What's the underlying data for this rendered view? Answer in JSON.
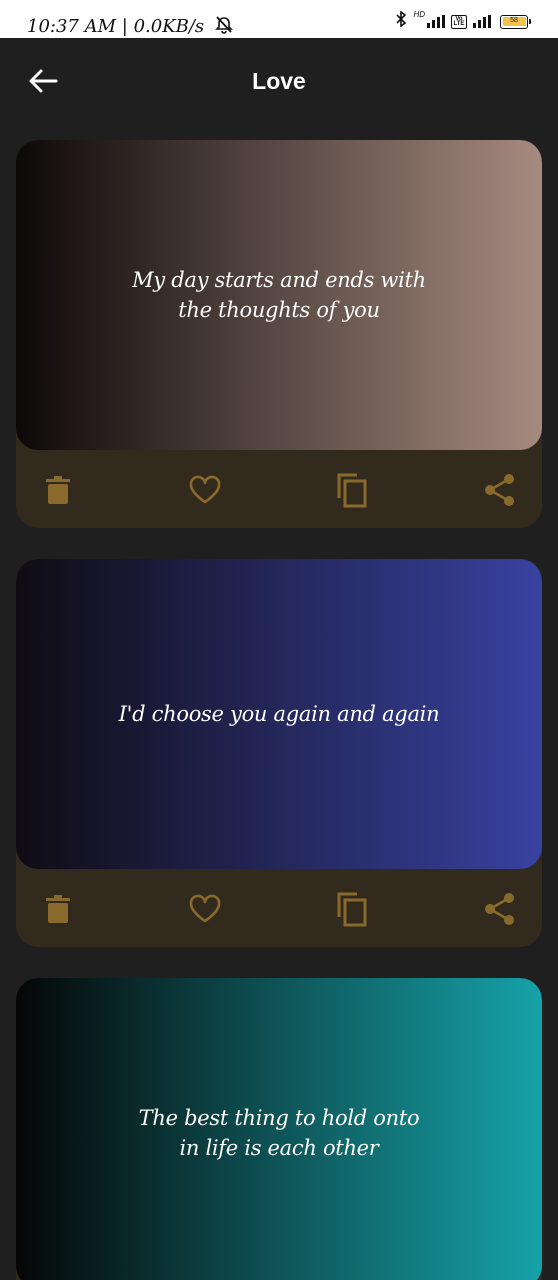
{
  "status_bar": {
    "time": "10:37 AM",
    "speed": "0.0KB/s",
    "network_hd_label": "HD",
    "volte_label": "Vo LTE",
    "battery_level": "58"
  },
  "app_bar": {
    "title": "Love"
  },
  "accent_color": "#7a5c26",
  "cards": [
    {
      "text": "My day starts and ends with\nthe thoughts of you",
      "gradient": [
        "#0d0909",
        "#a58a7f"
      ]
    },
    {
      "text": "I'd choose you again and again",
      "gradient": [
        "#0f0c14",
        "#3842a0"
      ]
    },
    {
      "text": "The best thing to hold onto\nin life is each other",
      "gradient": [
        "#060606",
        "#16a2a8"
      ]
    }
  ],
  "card_actions": [
    "trash-icon",
    "heart-icon",
    "copy-icon",
    "share-icon"
  ]
}
